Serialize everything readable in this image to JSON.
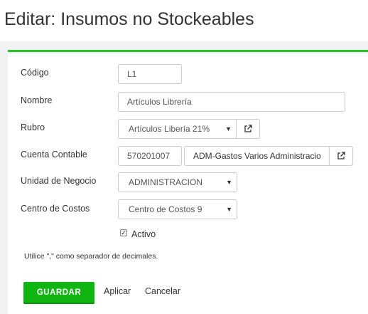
{
  "page": {
    "title": "Editar: Insumos no Stockeables"
  },
  "colors": {
    "accent": "#22c722",
    "primary_button": "#11b511"
  },
  "form": {
    "codigo": {
      "label": "Código",
      "value": "L1"
    },
    "nombre": {
      "label": "Nombre",
      "value": "Artículos Librería"
    },
    "rubro": {
      "label": "Rubro",
      "value": "Artículos Libería 21%",
      "link_icon": "external-link-icon"
    },
    "cuenta_contable": {
      "label": "Cuenta Contable",
      "code": "570201007",
      "name": "ADM-Gastos Varios Administracio",
      "link_icon": "external-link-icon"
    },
    "unidad_negocio": {
      "label": "Unidad de Negocio",
      "value": "ADMINISTRACION"
    },
    "centro_costos": {
      "label": "Centro de Costos",
      "value": "Centro de Costos 9"
    },
    "activo": {
      "label": "Activo",
      "checked": true
    },
    "hint": "Utilice \",\" como separador de decimales."
  },
  "actions": {
    "save_label": "GUARDAR",
    "apply_label": "Aplicar",
    "cancel_label": "Cancelar"
  }
}
